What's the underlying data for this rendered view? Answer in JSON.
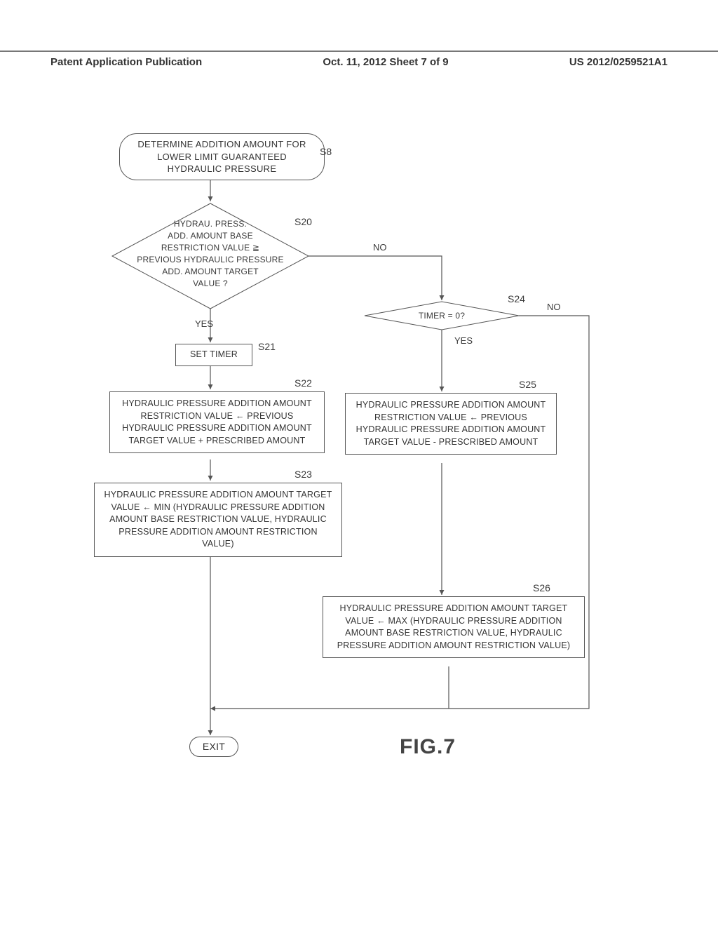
{
  "header": {
    "left": "Patent Application Publication",
    "center": "Oct. 11, 2012  Sheet 7 of 9",
    "right": "US 2012/0259521A1"
  },
  "steps": {
    "s8_label": "S8",
    "s20_label": "S20",
    "s21_label": "S21",
    "s22_label": "S22",
    "s23_label": "S23",
    "s24_label": "S24",
    "s25_label": "S25",
    "s26_label": "S26"
  },
  "branches": {
    "yes": "YES",
    "no": "NO",
    "yes2": "YES",
    "no2": "NO"
  },
  "boxes": {
    "start": "DETERMINE ADDITION AMOUNT FOR LOWER LIMIT GUARANTEED HYDRAULIC PRESSURE",
    "s20": {
      "l1": "HYDRAU. PRESS.",
      "l2": "ADD. AMOUNT BASE",
      "l3": "RESTRICTION VALUE ≧",
      "l4": "PREVIOUS HYDRAULIC PRESSURE",
      "l5": "ADD. AMOUNT TARGET",
      "l6": "VALUE ?"
    },
    "s21": "SET TIMER",
    "s22": "HYDRAULIC PRESSURE ADDITION AMOUNT RESTRICTION VALUE  ← PREVIOUS HYDRAULIC PRESSURE ADDITION AMOUNT TARGET VALUE  + PRESCRIBED AMOUNT",
    "s23": "HYDRAULIC PRESSURE ADDITION AMOUNT TARGET VALUE ← MIN (HYDRAULIC PRESSURE ADDITION AMOUNT BASE RESTRICTION VALUE, HYDRAULIC PRESSURE ADDITION AMOUNT RESTRICTION VALUE)",
    "s24": "TIMER = 0?",
    "s25": "HYDRAULIC PRESSURE ADDITION AMOUNT RESTRICTION VALUE ← PREVIOUS HYDRAULIC PRESSURE ADDITION AMOUNT TARGET VALUE - PRESCRIBED AMOUNT",
    "s26": "HYDRAULIC PRESSURE ADDITION AMOUNT TARGET VALUE ← MAX (HYDRAULIC PRESSURE ADDITION AMOUNT BASE RESTRICTION VALUE, HYDRAULIC PRESSURE ADDITION AMOUNT RESTRICTION VALUE)",
    "exit": "EXIT"
  },
  "figure_label": "FIG.7"
}
